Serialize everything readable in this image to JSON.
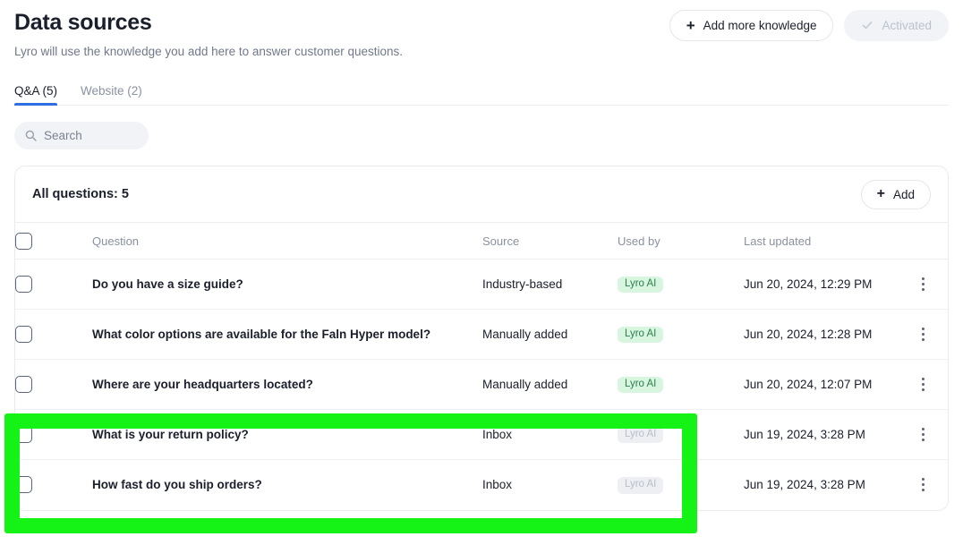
{
  "header": {
    "title": "Data sources",
    "subtitle": "Lyro will use the knowledge you add here to answer customer questions.",
    "add_knowledge_label": "Add more knowledge",
    "add_knowledge_icon": "plus-icon",
    "activated_label": "Activated",
    "activated_icon": "check-icon"
  },
  "tabs": [
    {
      "label": "Q&A (5)",
      "active": true
    },
    {
      "label": "Website (2)",
      "active": false
    }
  ],
  "search": {
    "placeholder": "Search",
    "value": "",
    "icon": "search-icon"
  },
  "card": {
    "title": "All questions: 5",
    "add_label": "Add",
    "add_icon": "plus-icon",
    "columns": [
      "Question",
      "Source",
      "Used by",
      "Last updated"
    ],
    "select_all_checked": false,
    "rows": [
      {
        "question": "Do you have a size guide?",
        "source": "Industry-based",
        "used_by": "Lyro AI",
        "used_by_state": "active",
        "last_updated": "Jun 20, 2024, 12:29 PM",
        "checked": false,
        "highlighted": false
      },
      {
        "question": "What color options are available for the Faln Hyper model?",
        "source": "Manually added",
        "used_by": "Lyro AI",
        "used_by_state": "active",
        "last_updated": "Jun 20, 2024, 12:28 PM",
        "checked": false,
        "highlighted": false
      },
      {
        "question": "Where are your headquarters located?",
        "source": "Manually added",
        "used_by": "Lyro AI",
        "used_by_state": "active",
        "last_updated": "Jun 20, 2024, 12:07 PM",
        "checked": false,
        "highlighted": false
      },
      {
        "question": "What is your return policy?",
        "source": "Inbox",
        "used_by": "Lyro AI",
        "used_by_state": "inactive",
        "last_updated": "Jun 19, 2024, 3:28 PM",
        "checked": false,
        "highlighted": true
      },
      {
        "question": "How fast do you ship orders?",
        "source": "Inbox",
        "used_by": "Lyro AI",
        "used_by_state": "inactive",
        "last_updated": "Jun 19, 2024, 3:28 PM",
        "checked": false,
        "highlighted": true
      }
    ],
    "row_menu_icon": "kebab-menu-icon"
  },
  "colors": {
    "accent_tab": "#2f6fe4",
    "badge_green_bg": "#d8f5e0",
    "badge_green_text": "#2f7d4d",
    "badge_grey_bg": "#edeff2",
    "badge_grey_text": "#b8bec9",
    "highlight_box": "#15f215",
    "text_primary": "#1a1f2b",
    "text_muted": "#8a91a0"
  }
}
